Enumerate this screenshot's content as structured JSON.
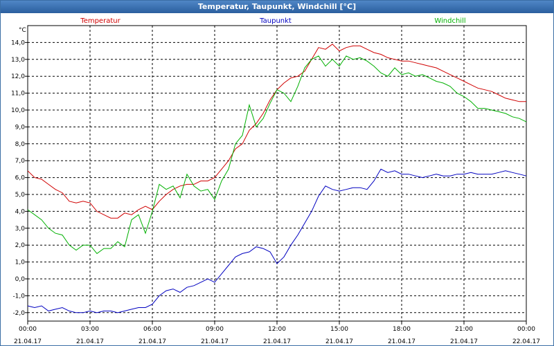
{
  "window": {
    "title": "Temperatur, Taupunkt, Windchill [°C]"
  },
  "chart_data": {
    "type": "line",
    "title": "Temperatur, Taupunkt, Windchill [°C]",
    "ylabel": "°C",
    "ylim": [
      -2.5,
      15.0
    ],
    "y_ticks": [
      "-2,0",
      "-1,0",
      "0,0",
      "1,0",
      "2,0",
      "3,0",
      "4,0",
      "5,0",
      "6,0",
      "7,0",
      "8,0",
      "9,0",
      "10,0",
      "11,0",
      "12,0",
      "13,0",
      "14,0"
    ],
    "x_ticks": [
      {
        "time": "00:00",
        "date": "21.04.17"
      },
      {
        "time": "03:00",
        "date": "21.04.17"
      },
      {
        "time": "06:00",
        "date": "21.04.17"
      },
      {
        "time": "09:00",
        "date": "21.04.17"
      },
      {
        "time": "12:00",
        "date": "21.04.17"
      },
      {
        "time": "15:00",
        "date": "21.04.17"
      },
      {
        "time": "18:00",
        "date": "21.04.17"
      },
      {
        "time": "21:00",
        "date": "21.04.17"
      },
      {
        "time": "00:00",
        "date": "22.04.17"
      }
    ],
    "xlim": [
      "21.04.17 00:00",
      "22.04.17 00:00"
    ],
    "grid": true,
    "legend_position": "top",
    "series": [
      {
        "name": "Temperatur",
        "color": "#d00000",
        "x": [
          "00:00",
          "00:20",
          "00:40",
          "01:00",
          "01:20",
          "01:40",
          "02:00",
          "02:20",
          "02:40",
          "03:00",
          "03:20",
          "03:40",
          "04:00",
          "04:20",
          "04:40",
          "05:00",
          "05:20",
          "05:40",
          "06:00",
          "06:20",
          "06:40",
          "07:00",
          "07:20",
          "07:40",
          "08:00",
          "08:20",
          "08:40",
          "09:00",
          "09:20",
          "09:40",
          "10:00",
          "10:20",
          "10:40",
          "11:00",
          "11:20",
          "11:40",
          "12:00",
          "12:20",
          "12:40",
          "13:00",
          "13:20",
          "13:40",
          "14:00",
          "14:20",
          "14:40",
          "15:00",
          "15:20",
          "15:40",
          "16:00",
          "16:20",
          "16:40",
          "17:00",
          "17:20",
          "17:40",
          "18:00",
          "18:20",
          "18:40",
          "19:00",
          "19:20",
          "19:40",
          "20:00",
          "20:20",
          "20:40",
          "21:00",
          "21:20",
          "21:40",
          "22:00",
          "22:20",
          "22:40",
          "23:00",
          "23:20",
          "23:40",
          "24:00"
        ],
        "y": [
          6.4,
          6.0,
          5.9,
          5.6,
          5.3,
          5.1,
          4.6,
          4.5,
          4.6,
          4.5,
          4.0,
          3.8,
          3.6,
          3.6,
          3.9,
          3.8,
          4.1,
          4.3,
          4.1,
          4.6,
          5.0,
          5.3,
          5.5,
          5.6,
          5.6,
          5.8,
          5.8,
          6.0,
          6.5,
          7.0,
          7.7,
          8.0,
          8.8,
          9.2,
          9.8,
          10.6,
          11.2,
          11.6,
          11.9,
          12.0,
          12.3,
          13.0,
          13.7,
          13.6,
          13.9,
          13.5,
          13.7,
          13.8,
          13.8,
          13.6,
          13.4,
          13.3,
          13.1,
          13.0,
          12.9,
          12.9,
          12.8,
          12.7,
          12.6,
          12.5,
          12.3,
          12.1,
          11.9,
          11.7,
          11.5,
          11.3,
          11.2,
          11.1,
          10.9,
          10.7,
          10.6,
          10.5,
          10.5
        ]
      },
      {
        "name": "Taupunkt",
        "color": "#0000c0",
        "x": [
          "00:00",
          "00:20",
          "00:40",
          "01:00",
          "01:20",
          "01:40",
          "02:00",
          "02:20",
          "02:40",
          "03:00",
          "03:20",
          "03:40",
          "04:00",
          "04:20",
          "04:40",
          "05:00",
          "05:20",
          "05:40",
          "06:00",
          "06:20",
          "06:40",
          "07:00",
          "07:20",
          "07:40",
          "08:00",
          "08:20",
          "08:40",
          "09:00",
          "09:20",
          "09:40",
          "10:00",
          "10:20",
          "10:40",
          "11:00",
          "11:20",
          "11:40",
          "12:00",
          "12:20",
          "12:40",
          "13:00",
          "13:20",
          "13:40",
          "14:00",
          "14:20",
          "14:40",
          "15:00",
          "15:20",
          "15:40",
          "16:00",
          "16:20",
          "16:40",
          "17:00",
          "17:20",
          "17:40",
          "18:00",
          "18:20",
          "18:40",
          "19:00",
          "19:20",
          "19:40",
          "20:00",
          "20:20",
          "20:40",
          "21:00",
          "21:20",
          "21:40",
          "22:00",
          "22:20",
          "22:40",
          "23:00",
          "23:20",
          "23:40",
          "24:00"
        ],
        "y": [
          -1.6,
          -1.7,
          -1.6,
          -1.9,
          -1.8,
          -1.7,
          -1.9,
          -2.0,
          -2.0,
          -1.9,
          -2.0,
          -1.9,
          -1.9,
          -2.0,
          -1.9,
          -1.8,
          -1.7,
          -1.7,
          -1.5,
          -1.0,
          -0.7,
          -0.6,
          -0.8,
          -0.5,
          -0.4,
          -0.2,
          0.0,
          -0.2,
          0.3,
          0.8,
          1.3,
          1.5,
          1.6,
          1.9,
          1.8,
          1.6,
          0.9,
          1.3,
          2.0,
          2.6,
          3.3,
          4.0,
          4.9,
          5.5,
          5.3,
          5.2,
          5.3,
          5.4,
          5.4,
          5.3,
          5.8,
          6.5,
          6.3,
          6.4,
          6.2,
          6.2,
          6.1,
          6.0,
          6.1,
          6.2,
          6.1,
          6.1,
          6.2,
          6.2,
          6.3,
          6.2,
          6.2,
          6.2,
          6.3,
          6.4,
          6.3,
          6.2,
          6.1
        ]
      },
      {
        "name": "Windchill",
        "color": "#00b000",
        "x": [
          "00:00",
          "00:20",
          "00:40",
          "01:00",
          "01:20",
          "01:40",
          "02:00",
          "02:20",
          "02:40",
          "03:00",
          "03:20",
          "03:40",
          "04:00",
          "04:20",
          "04:40",
          "05:00",
          "05:20",
          "05:40",
          "06:00",
          "06:20",
          "06:40",
          "07:00",
          "07:20",
          "07:40",
          "08:00",
          "08:20",
          "08:40",
          "09:00",
          "09:20",
          "09:40",
          "10:00",
          "10:20",
          "10:40",
          "11:00",
          "11:20",
          "11:40",
          "12:00",
          "12:20",
          "12:40",
          "13:00",
          "13:20",
          "13:40",
          "14:00",
          "14:20",
          "14:40",
          "15:00",
          "15:20",
          "15:40",
          "16:00",
          "16:20",
          "16:40",
          "17:00",
          "17:20",
          "17:40",
          "18:00",
          "18:20",
          "18:40",
          "19:00",
          "19:20",
          "19:40",
          "20:00",
          "20:20",
          "20:40",
          "21:00",
          "21:20",
          "21:40",
          "22:00",
          "22:20",
          "22:40",
          "23:00",
          "23:20",
          "23:40",
          "24:00"
        ],
        "y": [
          4.1,
          3.8,
          3.5,
          3.0,
          2.7,
          2.6,
          2.0,
          1.7,
          2.0,
          2.0,
          1.5,
          1.8,
          1.8,
          2.2,
          1.9,
          3.5,
          3.8,
          2.7,
          4.0,
          5.6,
          5.3,
          5.5,
          4.8,
          6.2,
          5.5,
          5.2,
          5.3,
          4.7,
          5.8,
          6.5,
          8.0,
          8.5,
          10.3,
          9.0,
          9.5,
          10.4,
          11.2,
          11.0,
          10.5,
          11.4,
          12.5,
          13.0,
          13.2,
          12.6,
          13.0,
          12.6,
          13.2,
          13.0,
          13.1,
          12.9,
          12.6,
          12.2,
          12.0,
          12.5,
          12.1,
          12.2,
          12.0,
          12.1,
          11.9,
          11.7,
          11.6,
          11.4,
          11.0,
          10.8,
          10.5,
          10.1,
          10.1,
          10.0,
          9.9,
          9.8,
          9.6,
          9.5,
          9.3
        ]
      }
    ]
  }
}
